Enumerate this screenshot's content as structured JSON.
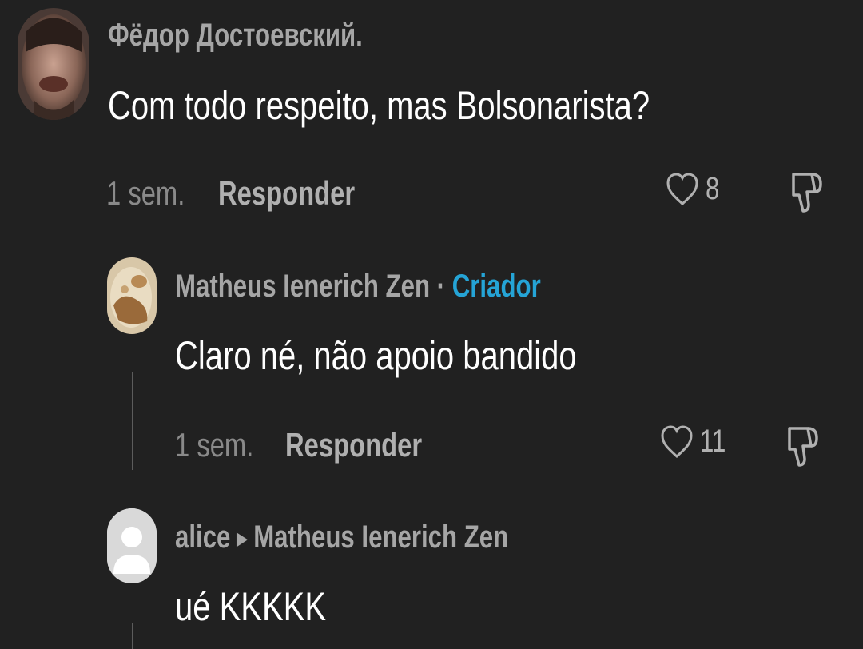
{
  "comments": [
    {
      "author": "Фёдор Достоевский.",
      "text": "Com todo respeito, mas Bolsonarista?",
      "time": "1 sem.",
      "reply_label": "Responder",
      "likes": "8"
    },
    {
      "author": "Matheus Ienerich Zen",
      "separator": "·",
      "badge": "Criador",
      "text": "Claro né, não apoio bandido",
      "time": "1 sem.",
      "reply_label": "Responder",
      "likes": "11"
    },
    {
      "author": "alice",
      "reply_to": "Matheus Ienerich Zen",
      "text": "ué KKKKK"
    }
  ],
  "icons": {
    "like": "heart-outline-icon",
    "dislike": "thumbs-down-outline-icon",
    "reply_arrow": "triangle-right-icon"
  },
  "colors": {
    "background": "#212121",
    "author": "#a6a6a6",
    "creator_badge": "#25a4d6",
    "text": "#ffffff",
    "meta": "#8a8a8a"
  }
}
